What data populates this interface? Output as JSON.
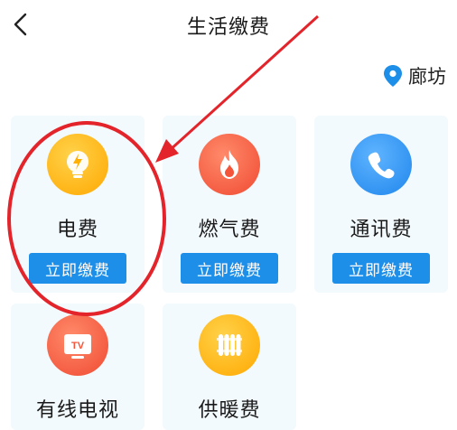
{
  "header": {
    "title": "生活缴费",
    "back_icon": "chevron-left-icon"
  },
  "location": {
    "city": "廊坊",
    "icon": "location-pin-icon",
    "color": "#1e8fe8"
  },
  "cards": [
    {
      "label": "电费",
      "button": "立即缴费",
      "icon": "lightning-bulb-icon",
      "color": "#ffb300"
    },
    {
      "label": "燃气费",
      "button": "立即缴费",
      "icon": "flame-icon",
      "color": "#f4553a"
    },
    {
      "label": "通讯费",
      "button": "立即缴费",
      "icon": "phone-icon",
      "color": "#2b8ff0"
    },
    {
      "label": "有线电视",
      "icon": "tv-icon",
      "color": "#f4553a"
    },
    {
      "label": "供暖费",
      "icon": "radiator-icon",
      "color": "#ffb300"
    }
  ],
  "annotation": {
    "arrow_color": "#e3242b",
    "circle_color": "#e3242b"
  }
}
